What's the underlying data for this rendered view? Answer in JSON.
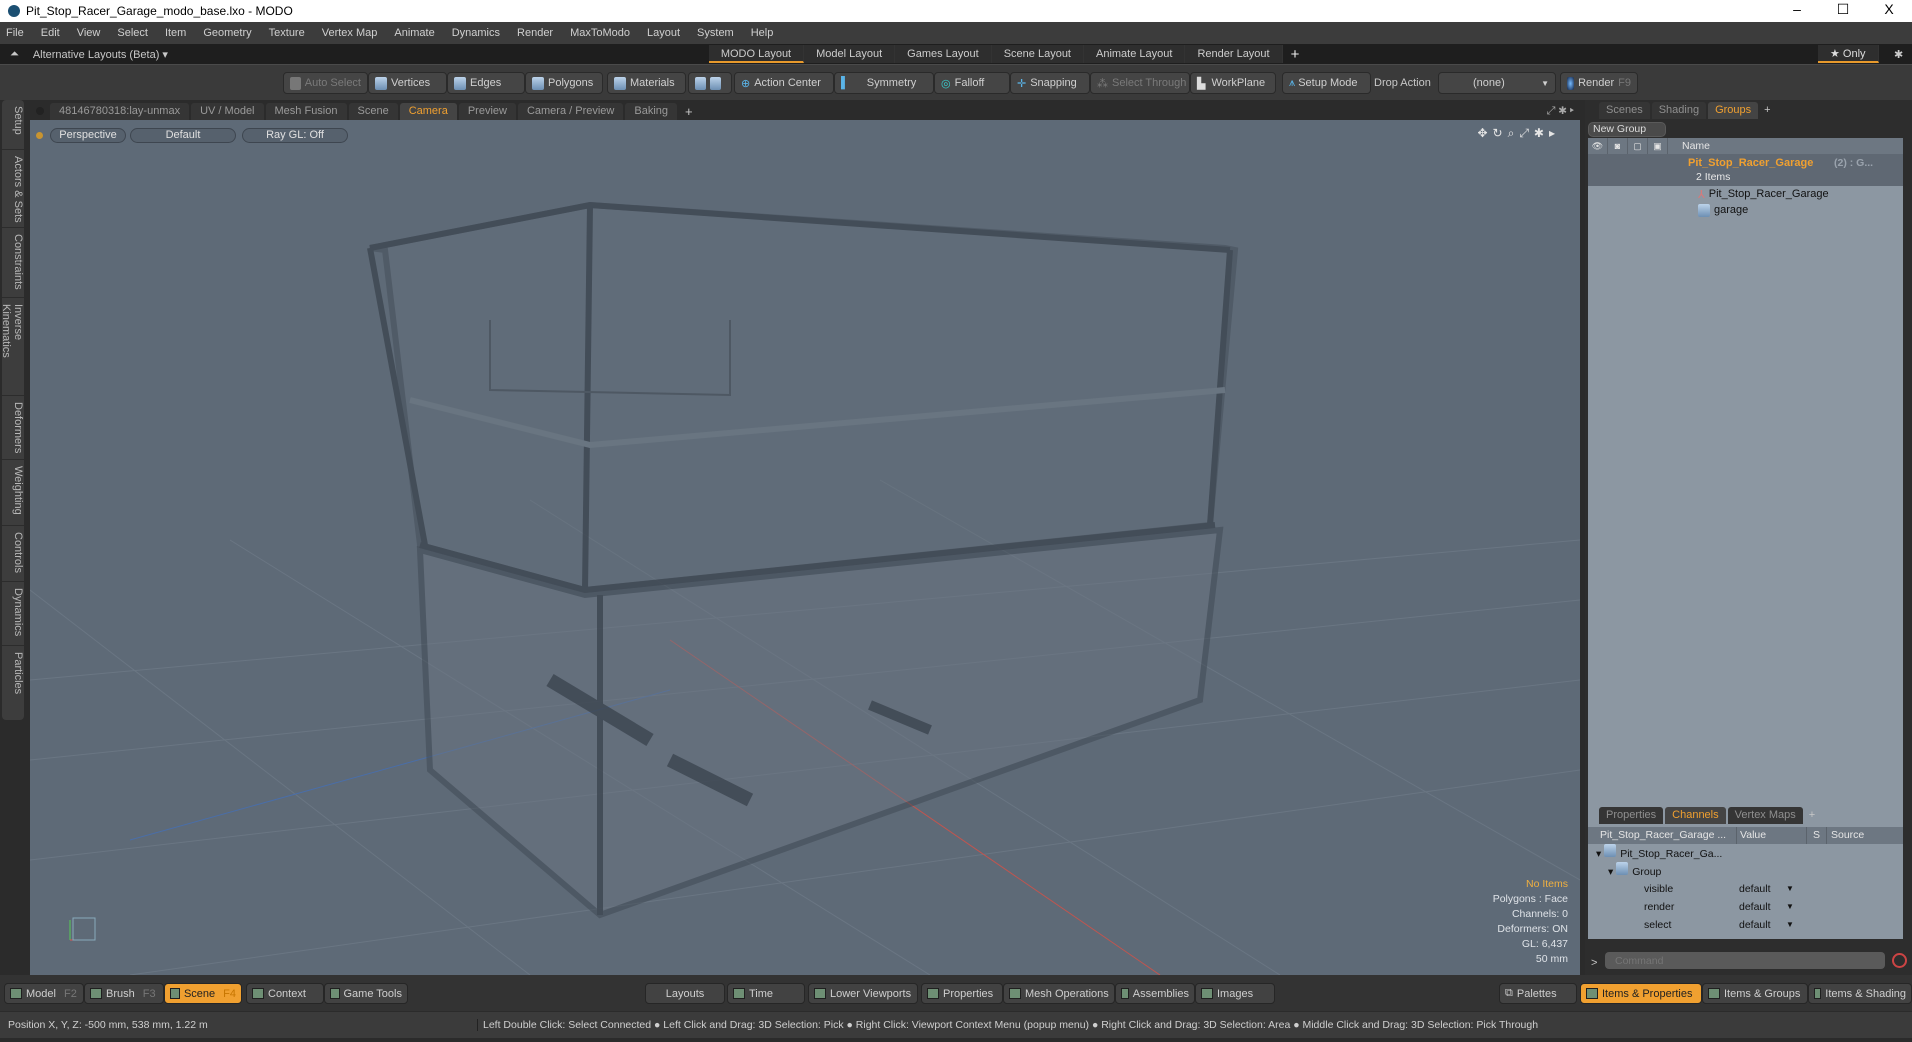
{
  "window": {
    "title": "Pit_Stop_Racer_Garage_modo_base.lxo - MODO",
    "minimize": "–",
    "maximize": "☐",
    "close": "X"
  },
  "menu": [
    "File",
    "Edit",
    "View",
    "Select",
    "Item",
    "Geometry",
    "Texture",
    "Vertex Map",
    "Animate",
    "Dynamics",
    "Render",
    "MaxToModo",
    "Layout",
    "System",
    "Help"
  ],
  "layouts": {
    "alt_label": "Alternative Layouts (Beta) ▾",
    "tabs": [
      "MODO Layout",
      "Model Layout",
      "Games Layout",
      "Scene Layout",
      "Animate Layout",
      "Render Layout"
    ],
    "add": "+",
    "only": "★ Only"
  },
  "toolbar": {
    "auto_select": "Auto Select",
    "vertices": "Vertices",
    "edges": "Edges",
    "polygons": "Polygons",
    "materials": "Materials",
    "action_center": "Action Center",
    "symmetry": "Symmetry",
    "falloff": "Falloff",
    "snapping": "Snapping",
    "select_through": "Select Through",
    "workplane": "WorkPlane",
    "setup_mode": "Setup Mode",
    "drop_action": "Drop Action",
    "drop_value": "(none)",
    "render": "Render",
    "render_key": "F9"
  },
  "viewport_tabs": [
    "48146780318:lay-unmax",
    "UV / Model",
    "Mesh Fusion",
    "Scene",
    "Camera",
    "Preview",
    "Camera / Preview",
    "Baking"
  ],
  "left_tabs": [
    "Setup",
    "Actors & Sets",
    "Constraints",
    "Inverse Kinematics",
    "Deformers",
    "Weighting",
    "Controls",
    "Dynamics",
    "Particles"
  ],
  "viewport": {
    "view": "Perspective",
    "shading": "Default",
    "raygl": "Ray GL: Off",
    "info": {
      "items": "No Items",
      "polygons": "Polygons : Face",
      "channels": "Channels: 0",
      "deformers": "Deformers: ON",
      "gl": "GL: 6,437",
      "scale": "50 mm"
    }
  },
  "groups": {
    "tabs": [
      "Scenes",
      "Shading",
      "Groups"
    ],
    "new_group": "New Group",
    "name_col": "Name",
    "root": "Pit_Stop_Racer_Garage",
    "root_suffix": "(2) : G...",
    "items_count": "2 Items",
    "children": [
      "Pit_Stop_Racer_Garage",
      "garage"
    ]
  },
  "channels": {
    "tabs": [
      "Properties",
      "Channels",
      "Vertex Maps"
    ],
    "cols": [
      "Pit_Stop_Racer_Garage ...",
      "Value",
      "S",
      "Source"
    ],
    "item": "Pit_Stop_Racer_Ga...",
    "group": "Group",
    "rows": [
      {
        "name": "visible",
        "value": "default"
      },
      {
        "name": "render",
        "value": "default"
      },
      {
        "name": "select",
        "value": "default"
      }
    ],
    "command_placeholder": "Command"
  },
  "bottom": {
    "model": "Model",
    "model_key": "F2",
    "brush": "Brush",
    "brush_key": "F3",
    "scene": "Scene",
    "scene_key": "F4",
    "context": "Context",
    "game_tools": "Game Tools",
    "layouts": "Layouts",
    "time": "Time",
    "lower_viewports": "Lower Viewports",
    "properties": "Properties",
    "mesh_operations": "Mesh Operations",
    "assemblies": "Assemblies",
    "images": "Images",
    "palettes": "Palettes",
    "items_properties": "Items & Properties",
    "items_groups": "Items & Groups",
    "items_shading": "Items & Shading"
  },
  "status": {
    "position": "Position X, Y, Z:  -500 mm, 538 mm, 1.22 m",
    "hints": "Left Double Click: Select Connected ● Left Click and Drag: 3D Selection: Pick ● Right Click: Viewport Context Menu (popup menu) ● Right Click and Drag: 3D Selection: Area ● Middle Click and Drag: 3D Selection: Pick Through"
  }
}
